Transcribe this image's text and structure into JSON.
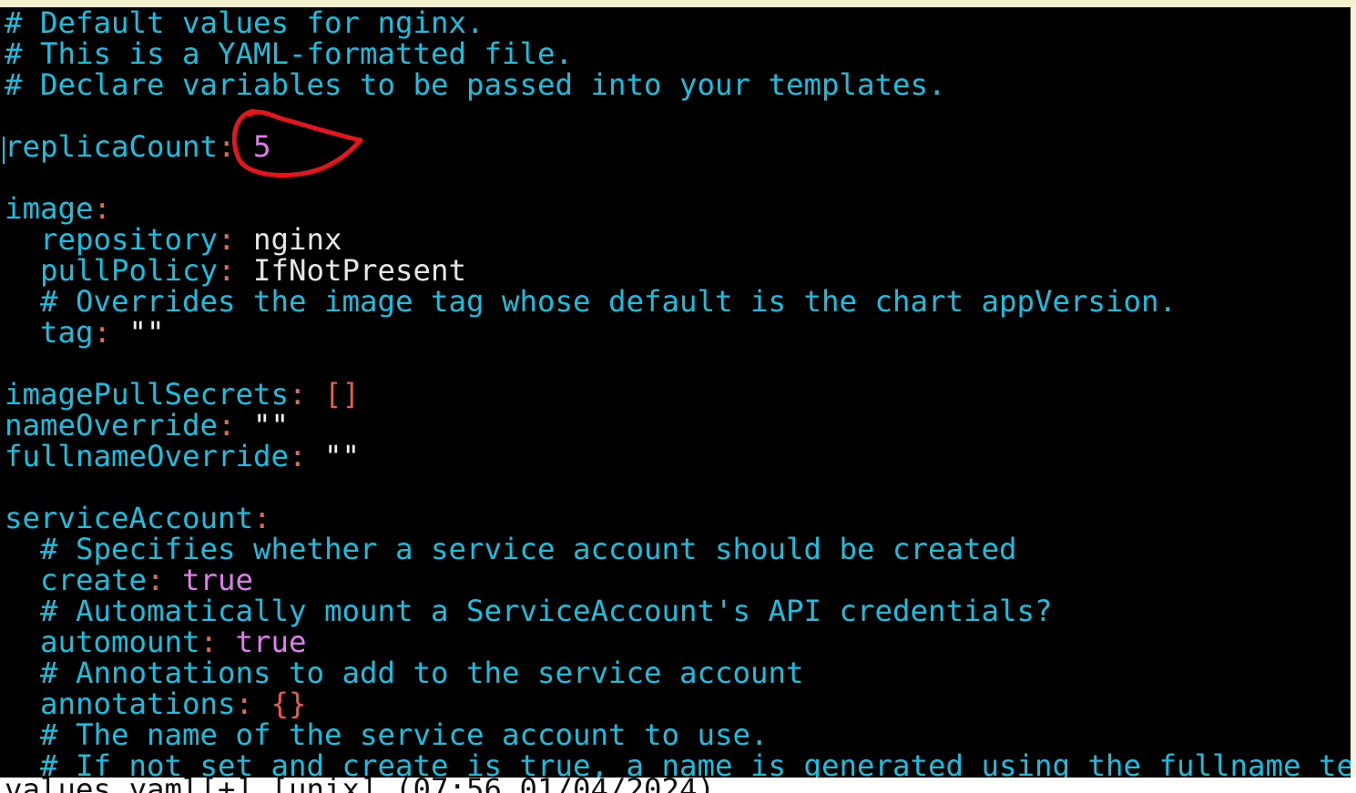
{
  "editor": {
    "lines": [
      [
        {
          "t": "# Default values for nginx.",
          "c": "cm"
        }
      ],
      [
        {
          "t": "# This is a YAML-formatted file.",
          "c": "cm"
        }
      ],
      [
        {
          "t": "# Declare variables to be passed into your templates.",
          "c": "cm"
        }
      ],
      [],
      [
        {
          "t": "replicaCount",
          "c": "ky"
        },
        {
          "t": ": ",
          "c": "pu"
        },
        {
          "t": "5",
          "c": "nm"
        }
      ],
      [],
      [
        {
          "t": "image",
          "c": "ky"
        },
        {
          "t": ":",
          "c": "pu"
        }
      ],
      [
        {
          "t": "  repository",
          "c": "ky"
        },
        {
          "t": ": ",
          "c": "pu"
        },
        {
          "t": "nginx",
          "c": "pl"
        }
      ],
      [
        {
          "t": "  pullPolicy",
          "c": "ky"
        },
        {
          "t": ": ",
          "c": "pu"
        },
        {
          "t": "IfNotPresent",
          "c": "pl"
        }
      ],
      [
        {
          "t": "  # Overrides the image tag whose default is the chart appVersion.",
          "c": "cm"
        }
      ],
      [
        {
          "t": "  tag",
          "c": "ky"
        },
        {
          "t": ": ",
          "c": "pu"
        },
        {
          "t": "\"\"",
          "c": "qt"
        }
      ],
      [],
      [
        {
          "t": "imagePullSecrets",
          "c": "ky"
        },
        {
          "t": ": ",
          "c": "pu"
        },
        {
          "t": "[]",
          "c": "br"
        }
      ],
      [
        {
          "t": "nameOverride",
          "c": "ky"
        },
        {
          "t": ": ",
          "c": "pu"
        },
        {
          "t": "\"\"",
          "c": "qt"
        }
      ],
      [
        {
          "t": "fullnameOverride",
          "c": "ky"
        },
        {
          "t": ": ",
          "c": "pu"
        },
        {
          "t": "\"\"",
          "c": "qt"
        }
      ],
      [],
      [
        {
          "t": "serviceAccount",
          "c": "ky"
        },
        {
          "t": ":",
          "c": "pu"
        }
      ],
      [
        {
          "t": "  # Specifies whether a service account should be created",
          "c": "cm"
        }
      ],
      [
        {
          "t": "  create",
          "c": "ky"
        },
        {
          "t": ": ",
          "c": "pu"
        },
        {
          "t": "true",
          "c": "nm"
        }
      ],
      [
        {
          "t": "  # Automatically mount a ServiceAccount's API credentials?",
          "c": "cm"
        }
      ],
      [
        {
          "t": "  automount",
          "c": "ky"
        },
        {
          "t": ": ",
          "c": "pu"
        },
        {
          "t": "true",
          "c": "nm"
        }
      ],
      [
        {
          "t": "  # Annotations to add to the service account",
          "c": "cm"
        }
      ],
      [
        {
          "t": "  annotations",
          "c": "ky"
        },
        {
          "t": ": ",
          "c": "pu"
        },
        {
          "t": "{}",
          "c": "br"
        }
      ],
      [
        {
          "t": "  # The name of the service account to use.",
          "c": "cm"
        }
      ],
      [
        {
          "t": "  # If not set and create is true, a name is generated using the fullname te",
          "c": "cm"
        }
      ]
    ]
  },
  "status_bar": {
    "text": "values.yaml[+] [unix] (07:56 01/04/2024)"
  },
  "colors": {
    "background": "#000000",
    "comment_key": "#17bfe0",
    "punctuation": "#e06a52",
    "number_bool": "#e27bf0",
    "plain": "#e6e6e6",
    "annotation": "#e8141c"
  }
}
